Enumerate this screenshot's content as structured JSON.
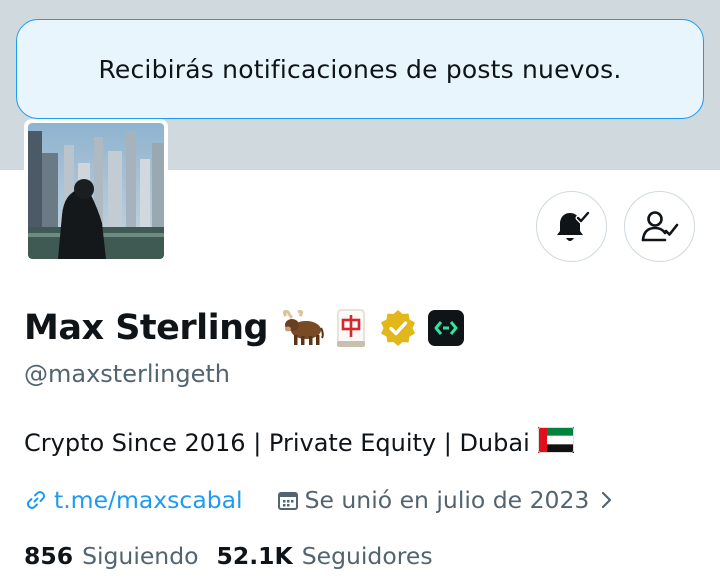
{
  "toast": {
    "message": "Recibirás notificaciones de posts nuevos."
  },
  "profile": {
    "name": "Max Sterling",
    "handle": "@maxsterlingeth",
    "bio": "Crypto Since 2016 | Private Equity | Dubai",
    "name_badges": [
      "ox-emoji",
      "mahjong-red-dragon-emoji",
      "verified-gold-badge",
      "affiliate-badge"
    ],
    "bio_flag": "uae-flag-emoji",
    "link": "t.me/maxscabal",
    "joined": "Se unió en julio de 2023"
  },
  "stats": {
    "following_count": "856",
    "following_label": "Siguiendo",
    "followers_count": "52.1K",
    "followers_label": "Seguidores"
  },
  "actions": {
    "notifications_icon": "bell-with-check-icon",
    "follow_icon": "person-with-check-icon"
  },
  "colors": {
    "accent": "#1d9bf0",
    "text_primary": "#0f1419",
    "text_secondary": "#536471",
    "banner": "#cfd9de",
    "toast_bg": "#e8f5fd",
    "verified_gold": "#e2b719"
  }
}
